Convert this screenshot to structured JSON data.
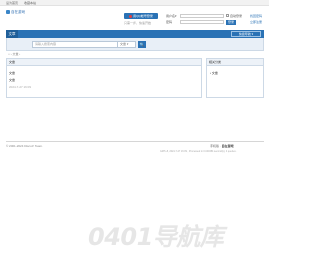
{
  "topbar": {
    "left": "设为首页",
    "right": "收藏本站"
  },
  "logo": {
    "text": "自在游戏"
  },
  "register": {
    "button": "用QQ帐号登录",
    "note": "只需一步，快速开始"
  },
  "login": {
    "user_label": "用户名",
    "user_select": "▾",
    "remember": "自动登录",
    "find_pwd": "找回密码",
    "pass_label": "密码",
    "submit": "登录",
    "register": "立即注册"
  },
  "nav": {
    "active": "文章",
    "quick": "快捷导航 ▾"
  },
  "search": {
    "placeholder": "请输入搜索内容",
    "scope": "文章 ▾",
    "go": "🔍"
  },
  "breadcrumb": "⌂ › 文章 ›",
  "article": {
    "header": "文章",
    "lines": [
      "文章",
      "文章"
    ],
    "date": "2024-7-27 16:09"
  },
  "sidebar": {
    "header": "相关分类",
    "items": [
      "• 文章"
    ]
  },
  "footer": {
    "copyright": "© 2001-2024 Discuz! Team.",
    "right_label": "手机版 · ",
    "right_strong": "自在游戏",
    "sub": "GMT+8, 2024-7-27 16:09 , Processed in 0.040384 second(s), 4 queries ."
  },
  "watermark": "0401导航库"
}
